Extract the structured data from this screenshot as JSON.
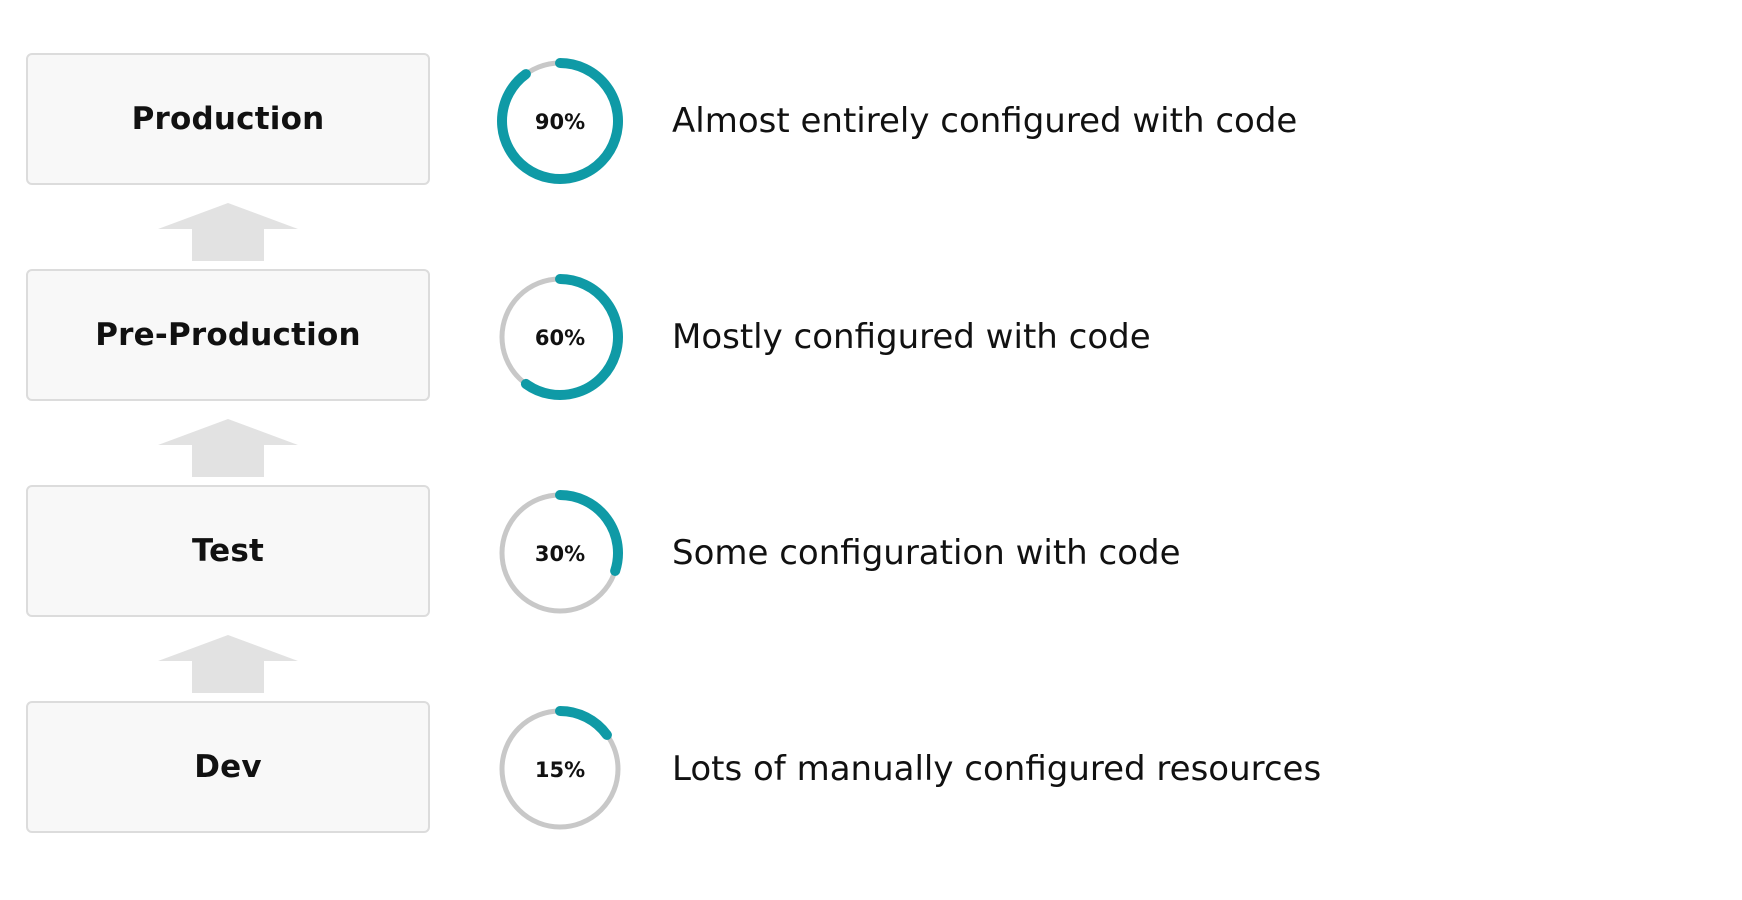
{
  "colors": {
    "accent": "#0f9aa6",
    "track": "#c8c8c8",
    "box_fill": "#f8f8f8",
    "box_border": "#dcdcdc",
    "arrow": "#e2e2e2"
  },
  "stages": [
    {
      "label": "Production",
      "percent_label": "90%",
      "percent": 0.9,
      "description": "Almost entirely configured with code"
    },
    {
      "label": "Pre-Production",
      "percent_label": "60%",
      "percent": 0.6,
      "description": "Mostly configured with code"
    },
    {
      "label": "Test",
      "percent_label": "30%",
      "percent": 0.3,
      "description": "Some configuration with code"
    },
    {
      "label": "Dev",
      "percent_label": "15%",
      "percent": 0.15,
      "description": "Lots of manually configured resources"
    }
  ],
  "arrow_icon": "up-arrow-icon"
}
